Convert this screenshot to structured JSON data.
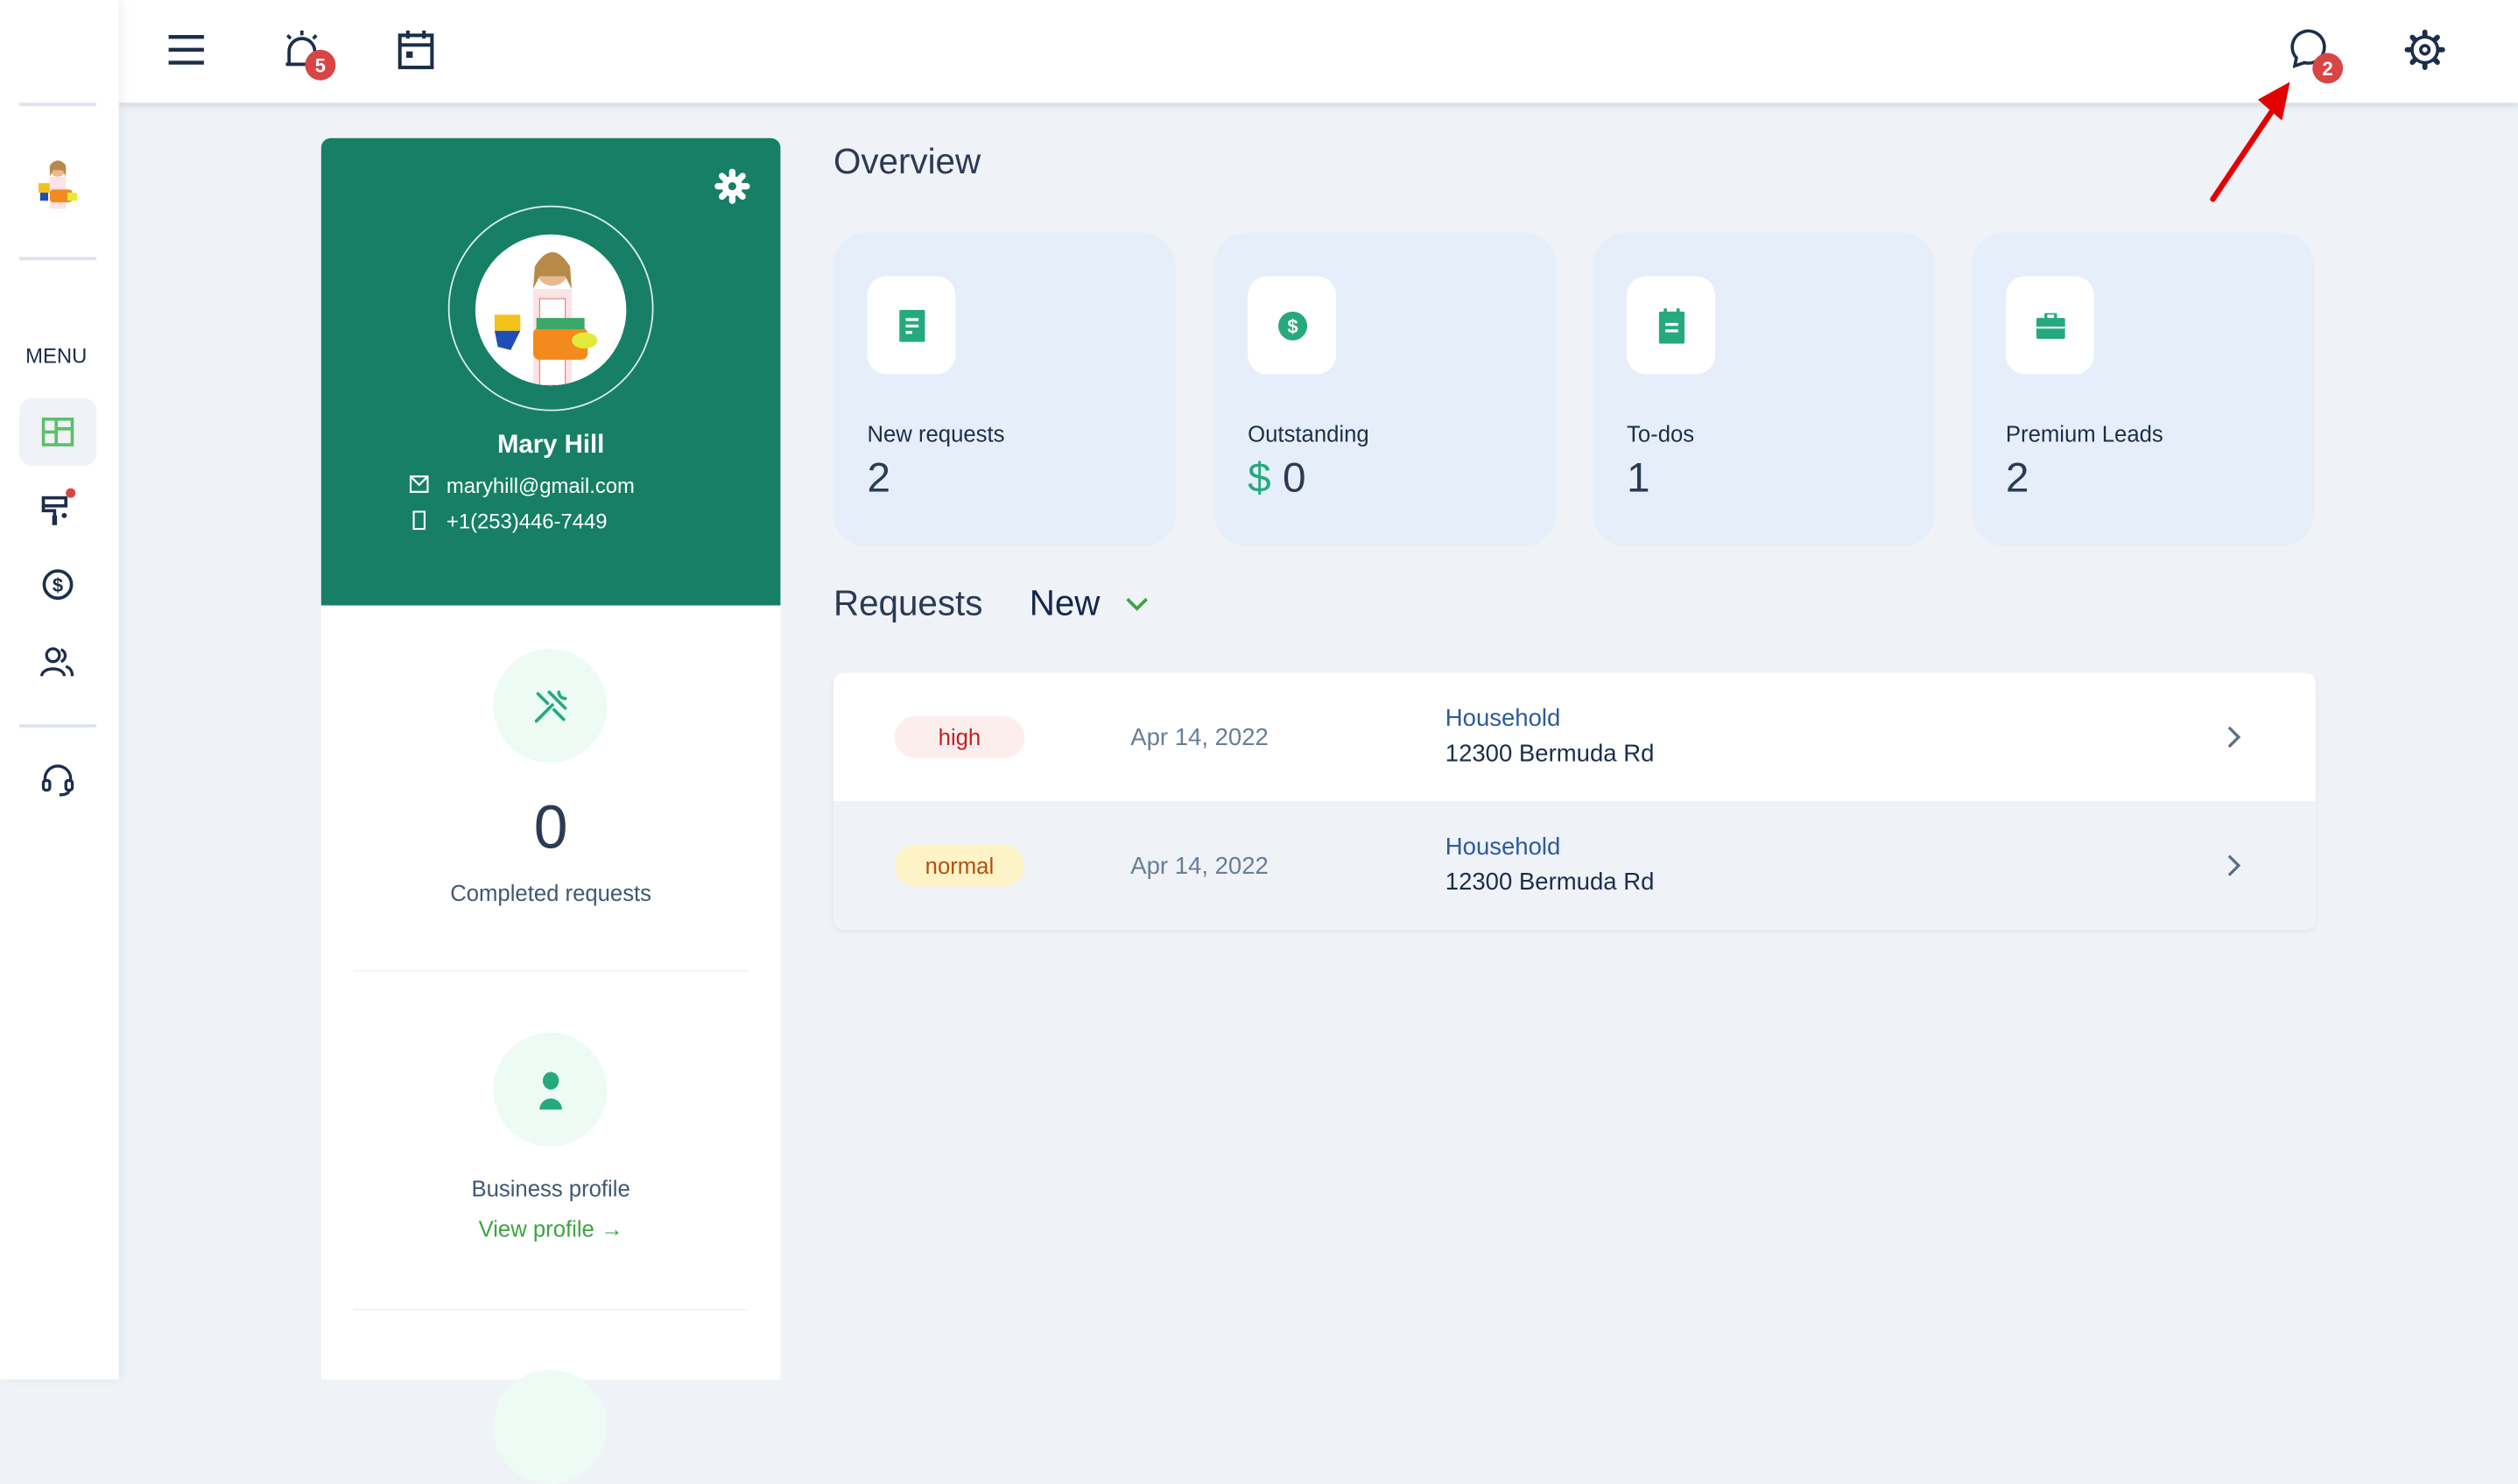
{
  "topbar": {
    "alarm_badge": "5",
    "chat_badge": "2"
  },
  "sidebar": {
    "menu_label": "MENU",
    "items": [
      "dashboard",
      "services",
      "payments",
      "customers",
      "support"
    ]
  },
  "profile": {
    "name": "Mary Hill",
    "email": "maryhill@gmail.com",
    "phone": "+1(253)446-7449",
    "completed_count": "0",
    "completed_label": "Completed requests",
    "business_label": "Business profile",
    "view_profile": "View profile →"
  },
  "overview": {
    "title": "Overview",
    "cards": [
      {
        "label": "New requests",
        "value": "2",
        "icon": "document-icon"
      },
      {
        "label": "Outstanding",
        "currency": "$",
        "value": "0",
        "icon": "dollar-icon"
      },
      {
        "label": "To-dos",
        "value": "1",
        "icon": "clipboard-icon"
      },
      {
        "label": "Premium Leads",
        "value": "2",
        "icon": "briefcase-icon"
      }
    ]
  },
  "requests": {
    "title": "Requests",
    "filter": "New",
    "rows": [
      {
        "priority": "high",
        "date": "Apr 14, 2022",
        "category": "Household",
        "address": "12300 Bermuda Rd"
      },
      {
        "priority": "normal",
        "date": "Apr 14, 2022",
        "category": "Household",
        "address": "12300 Bermuda Rd"
      }
    ]
  },
  "colors": {
    "brand": "#167f66",
    "accent": "#26a97f",
    "badge": "#d94545",
    "high": "#c81e1e",
    "normal": "#b4500f"
  }
}
